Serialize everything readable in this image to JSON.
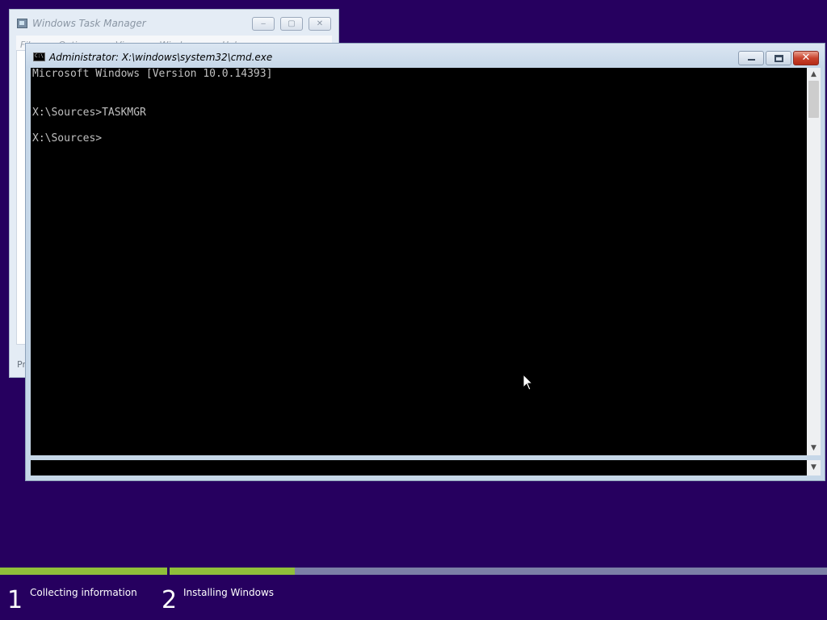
{
  "task_manager": {
    "title": "Windows Task Manager",
    "menu": [
      "File",
      "Options",
      "View",
      "Windows",
      "Help"
    ],
    "status_partial": "Pr",
    "buttons": {
      "minimize": "‒",
      "maximize": "▢",
      "close": "✕"
    }
  },
  "cmd_window": {
    "title": "Administrator: X:\\windows\\system32\\cmd.exe",
    "icon_text": "C:\\",
    "lines": [
      "Microsoft Windows [Version 10.0.14393]",
      "X:\\Sources>TASKMGR",
      "X:\\Sources>"
    ],
    "colors": {
      "console_bg": "#000000",
      "console_fg": "#c0c0c0"
    }
  },
  "setup_steps": [
    {
      "number": "1",
      "label": "Collecting information",
      "progress": 1.0
    },
    {
      "number": "2",
      "label": "Installing Windows",
      "progress": 0.19
    }
  ],
  "colors": {
    "desktop_bg": "#26005f",
    "progress_fill": "#8fbf3a",
    "progress_track": "#7b7fa6"
  }
}
